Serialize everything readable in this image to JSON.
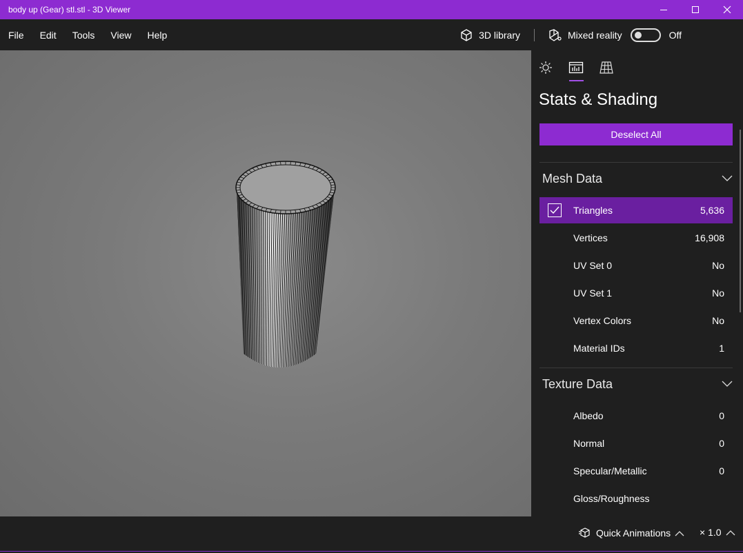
{
  "window": {
    "title": "body up  (Gear) stl.stl - 3D Viewer"
  },
  "menu": {
    "items": [
      "File",
      "Edit",
      "Tools",
      "View",
      "Help"
    ]
  },
  "toolbar": {
    "library_label": "3D library",
    "mixed_reality_label": "Mixed reality",
    "toggle_state": "Off"
  },
  "panel": {
    "tabs": [
      "sun-icon",
      "stats-icon",
      "grid-icon"
    ],
    "title": "Stats & Shading",
    "deselect_label": "Deselect All",
    "mesh": {
      "heading": "Mesh Data",
      "rows": [
        {
          "label": "Triangles",
          "value": "5,636",
          "checked": true
        },
        {
          "label": "Vertices",
          "value": "16,908"
        },
        {
          "label": "UV Set 0",
          "value": "No"
        },
        {
          "label": "UV Set 1",
          "value": "No"
        },
        {
          "label": "Vertex Colors",
          "value": "No"
        },
        {
          "label": "Material IDs",
          "value": "1"
        }
      ]
    },
    "texture": {
      "heading": "Texture Data",
      "rows": [
        {
          "label": "Albedo",
          "value": "0"
        },
        {
          "label": "Normal",
          "value": "0"
        },
        {
          "label": "Specular/Metallic",
          "value": "0"
        },
        {
          "label": "Gloss/Roughness",
          "value": ""
        }
      ]
    }
  },
  "bottom": {
    "animations_label": "Quick Animations",
    "speed_label": "× 1.0"
  },
  "colors": {
    "accent": "#8d2bd1",
    "selected_row": "#6a1fa0",
    "background": "#1f1f1f"
  }
}
